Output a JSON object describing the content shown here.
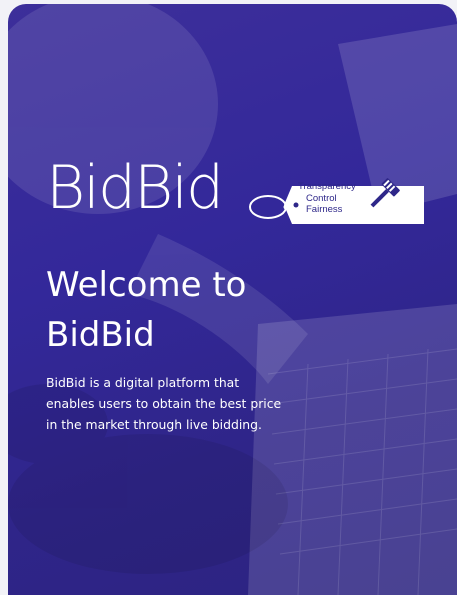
{
  "brand": {
    "name": "BidBid",
    "tagline": [
      "Transparency",
      "Control",
      "Fairness"
    ],
    "logo_icon": "gavel-icon"
  },
  "welcome": {
    "line1": "Welcome to",
    "line2": "BidBid"
  },
  "description": "BidBid is a digital platform that enables users to obtain the best price in the market through live bidding.",
  "colors": {
    "background": "#33289a",
    "text": "#ffffff",
    "tag_text": "#2e2789"
  }
}
